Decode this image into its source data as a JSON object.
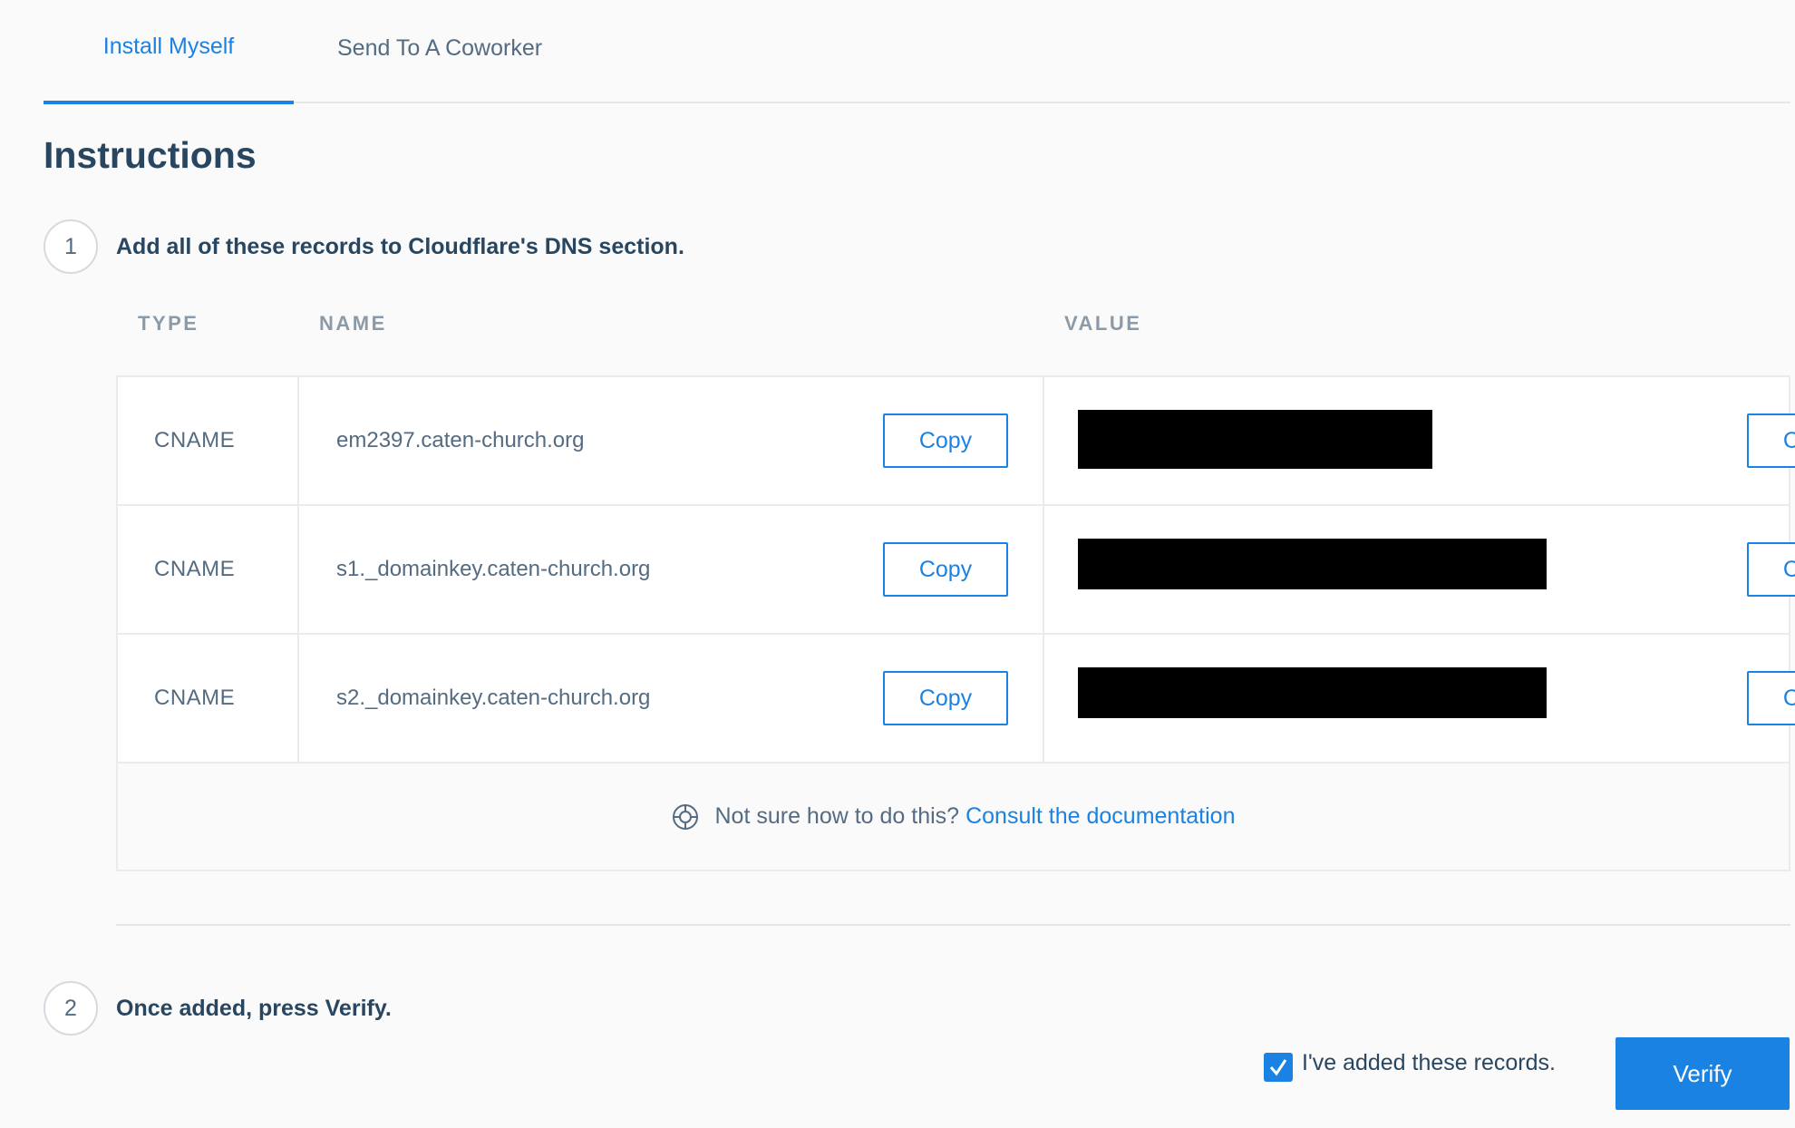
{
  "tabs": [
    {
      "label": "Install Myself",
      "active": true
    },
    {
      "label": "Send To A Coworker",
      "active": false
    }
  ],
  "title": "Instructions",
  "steps": [
    {
      "number": "1",
      "text": "Add all of these records to Cloudflare's DNS section."
    },
    {
      "number": "2",
      "text": "Once added, press Verify."
    }
  ],
  "table": {
    "headers": {
      "type": "TYPE",
      "name": "NAME",
      "value": "VALUE"
    },
    "copy_label": "Copy",
    "rows": [
      {
        "type": "CNAME",
        "name": "em2397.caten-church.org",
        "value": "[redacted]"
      },
      {
        "type": "CNAME",
        "name": "s1._domainkey.caten-church.org",
        "value": "[redacted]"
      },
      {
        "type": "CNAME",
        "name": "s2._domainkey.caten-church.org",
        "value": "[redacted]"
      }
    ],
    "help": {
      "text": "Not sure how to do this?",
      "link": "Consult the documentation",
      "icon": "lifebuoy-icon"
    }
  },
  "confirm": {
    "label": "I've added these records.",
    "checked": true
  },
  "verify_label": "Verify",
  "colors": {
    "accent": "#1a82e2",
    "heading": "#294661",
    "muted": "#546b81"
  }
}
